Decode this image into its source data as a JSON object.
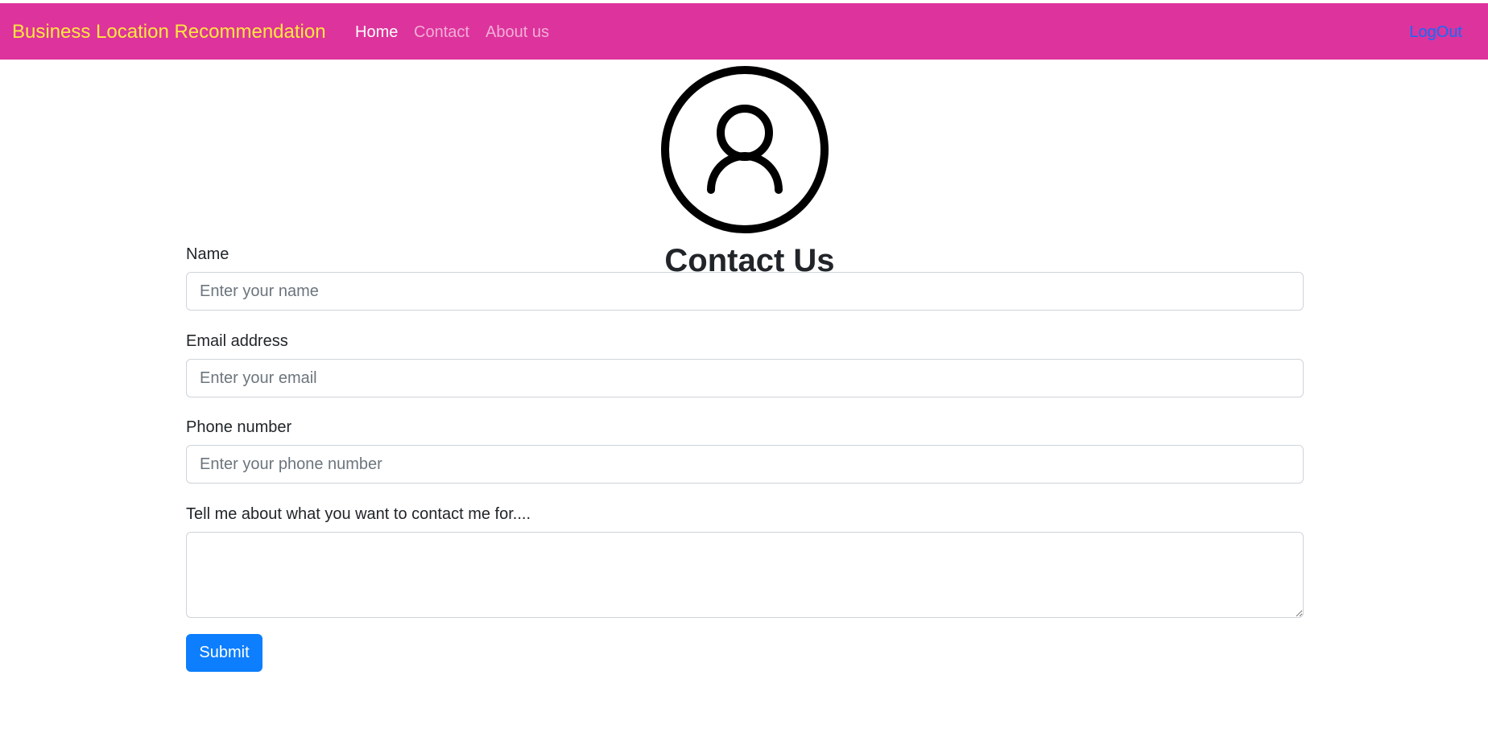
{
  "navbar": {
    "brand": "Business Location Recommendation",
    "links": [
      {
        "label": "Home"
      },
      {
        "label": "Contact"
      },
      {
        "label": "About us"
      }
    ],
    "logout_label": "LogOut",
    "background_color": "#dd339c",
    "brand_color": "#ffe83d"
  },
  "avatar": {
    "icon": "user-circle-icon"
  },
  "page": {
    "title": "Contact Us"
  },
  "form": {
    "name": {
      "label": "Name",
      "placeholder": "Enter your name",
      "value": ""
    },
    "email": {
      "label": "Email address",
      "placeholder": "Enter your email",
      "value": ""
    },
    "phone": {
      "label": "Phone number",
      "placeholder": "Enter your phone number",
      "value": ""
    },
    "message": {
      "label": "Tell me about what you want to contact me for....",
      "value": ""
    },
    "submit_label": "Submit",
    "submit_color": "#0d7efd"
  }
}
